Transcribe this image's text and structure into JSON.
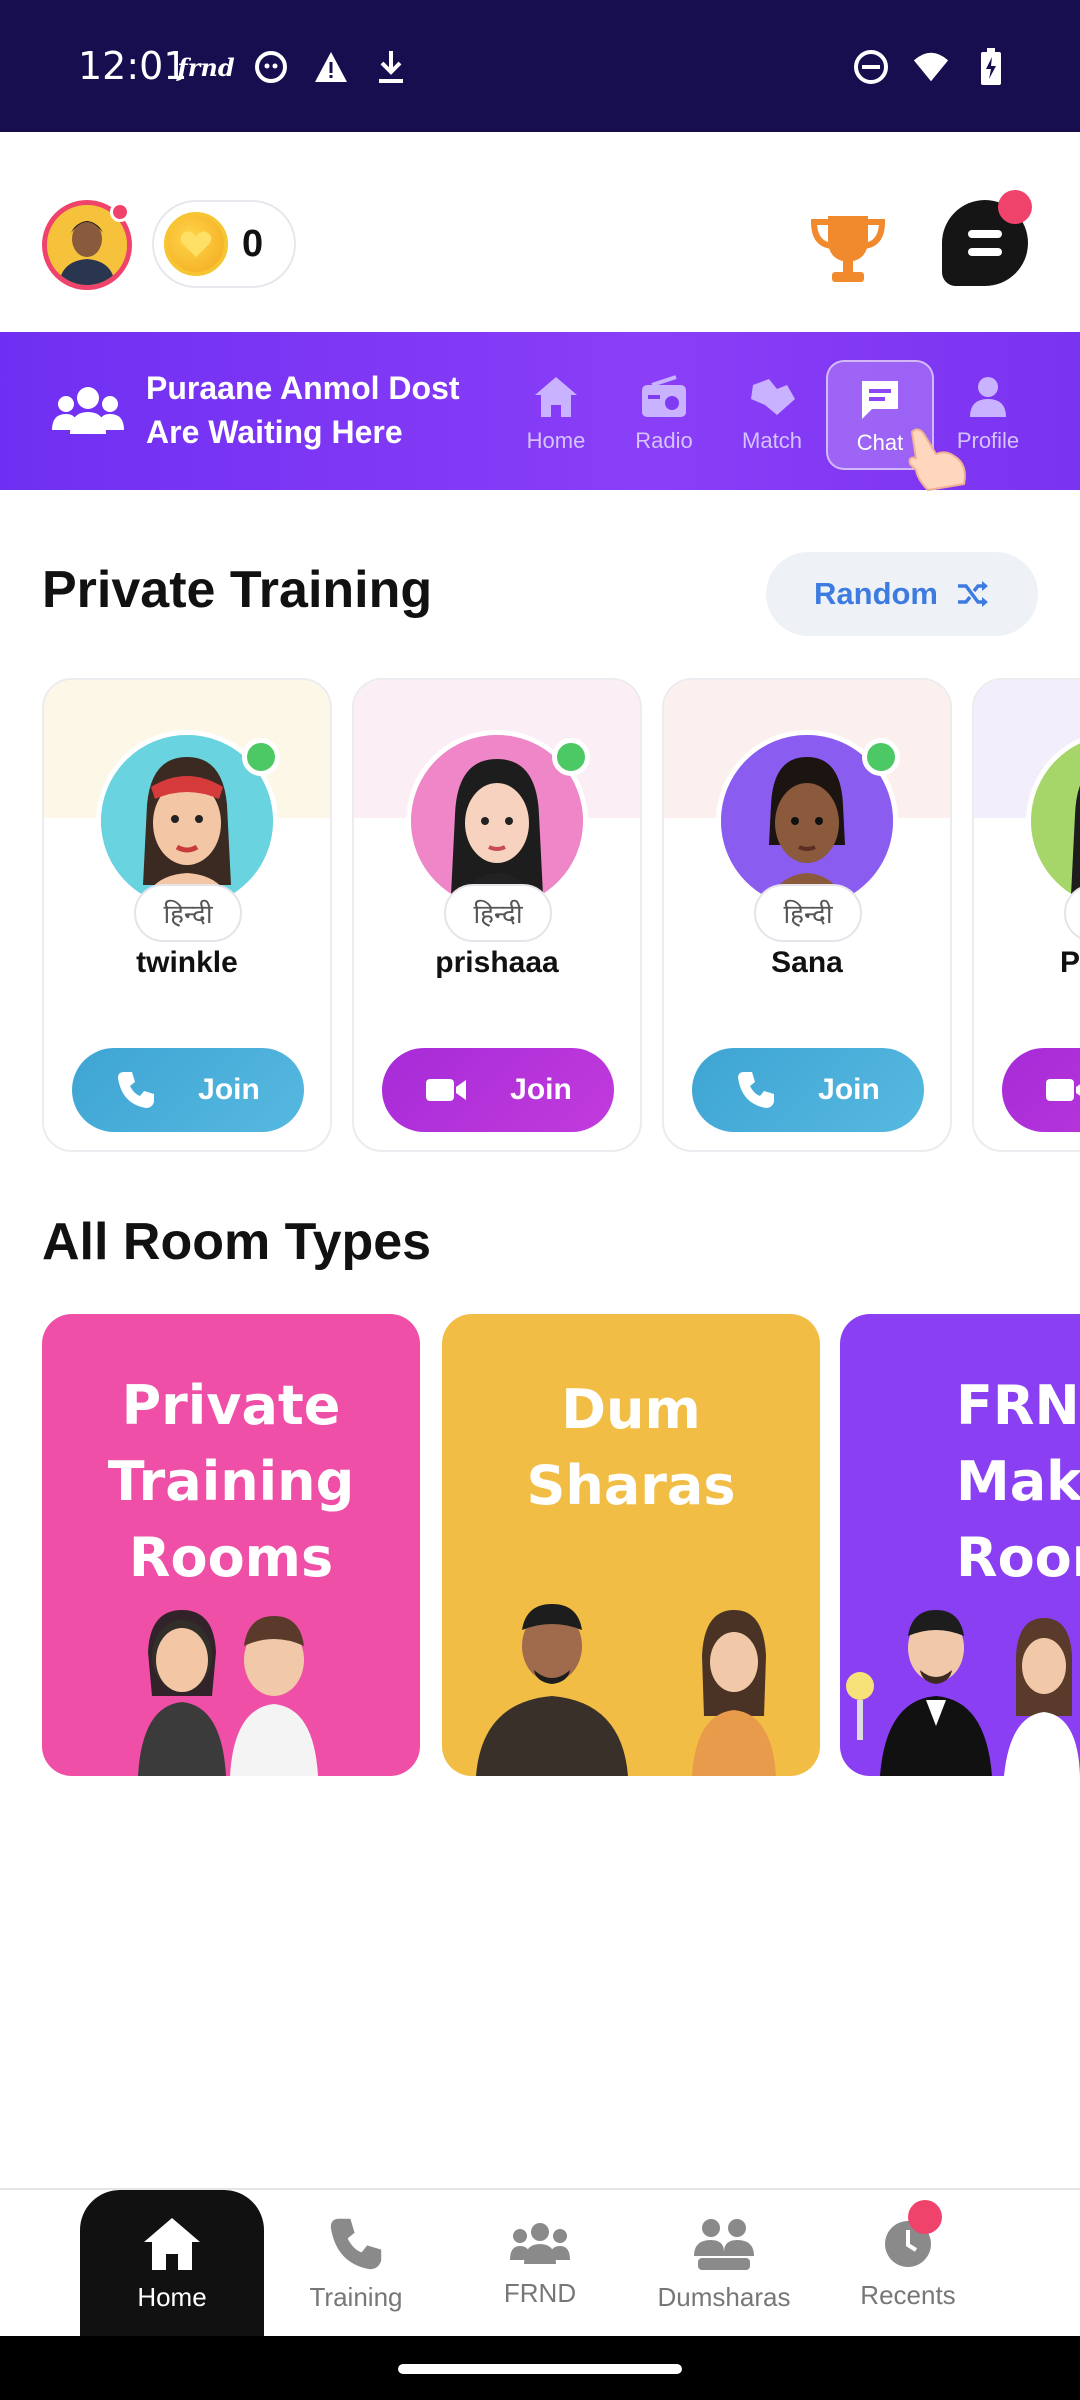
{
  "status_bar": {
    "time": "12:01",
    "frnd_notification": "frnd"
  },
  "header": {
    "coin_count": "0"
  },
  "banner": {
    "line1": "Puraane Anmol Dost",
    "line2": "Are Waiting Here",
    "nav": [
      {
        "label": "Home",
        "icon": "home-icon"
      },
      {
        "label": "Radio",
        "icon": "radio-icon"
      },
      {
        "label": "Match",
        "icon": "match-icon"
      },
      {
        "label": "Chat",
        "icon": "chat-icon",
        "active": true
      },
      {
        "label": "Profile",
        "icon": "profile-icon"
      }
    ]
  },
  "private_training": {
    "title": "Private Training",
    "random_label": "Random",
    "cards": [
      {
        "name": "twinkle",
        "language": "हिन्दी",
        "join_label": "Join",
        "call_type": "voice",
        "online": true
      },
      {
        "name": "prishaaa",
        "language": "हिन्दी",
        "join_label": "Join",
        "call_type": "video",
        "online": true
      },
      {
        "name": "Sana",
        "language": "हिन्दी",
        "join_label": "Join",
        "call_type": "voice",
        "online": true
      },
      {
        "name": "P",
        "language": "",
        "join_label": "",
        "call_type": "video",
        "online": false
      }
    ]
  },
  "room_types": {
    "title": "All Room Types",
    "rooms": [
      {
        "title_lines": [
          "Private",
          "Training",
          "Rooms"
        ],
        "color": "#ef4fa6"
      },
      {
        "title_lines": [
          "Dum",
          "Sharas"
        ],
        "color": "#f2bd45"
      },
      {
        "title_lines": [
          "FRND",
          "Makin",
          "Room"
        ],
        "color": "#8a40f2"
      }
    ]
  },
  "bottom_nav": [
    {
      "label": "Home",
      "icon": "home-icon",
      "active": true
    },
    {
      "label": "Training",
      "icon": "phone-icon"
    },
    {
      "label": "FRND",
      "icon": "friends-icon"
    },
    {
      "label": "Dumsharas",
      "icon": "group-icon"
    },
    {
      "label": "Recents",
      "icon": "clock-icon"
    }
  ],
  "colors": {
    "status_bar": "#170e4f",
    "banner": "#7a33f0",
    "accent_red": "#f0436b",
    "online_green": "#4cc864",
    "voice_join": "#3ea4d3",
    "video_join": "#a62bd8"
  }
}
